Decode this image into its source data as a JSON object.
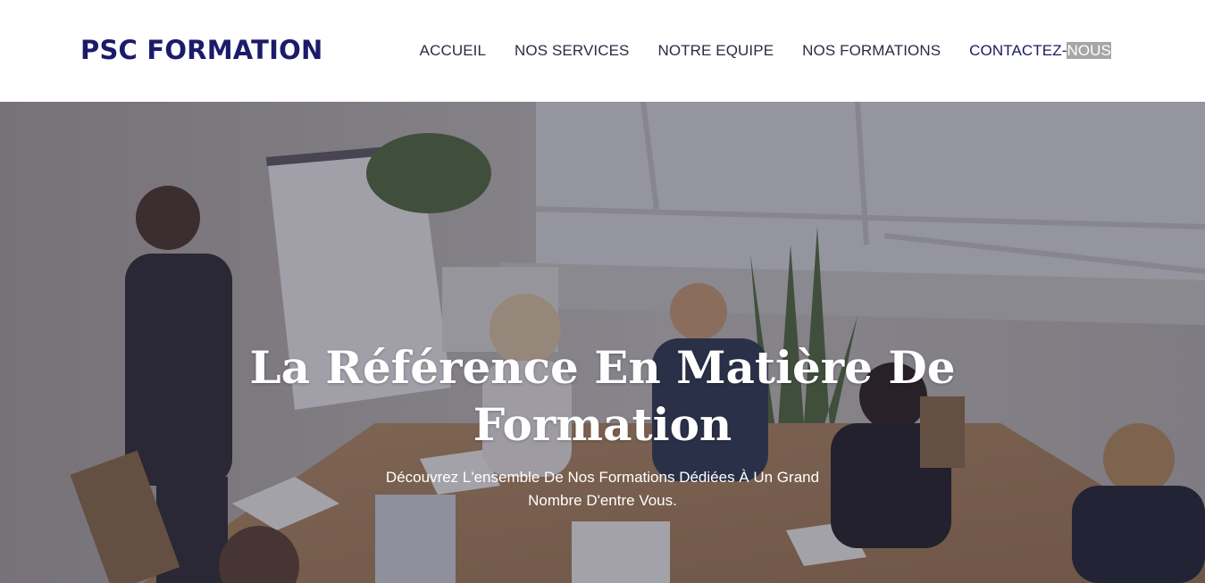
{
  "colors": {
    "brand": "#1b1b6b",
    "nav_text": "#2b2b45",
    "highlight_bg": "#a6a6a6",
    "hero_text": "#ffffff"
  },
  "header": {
    "logo": "PSC FORMATION",
    "nav": {
      "accueil": "ACCUEIL",
      "services": "NOS SERVICES",
      "equipe": "NOTRE EQUIPE",
      "formations": "NOS FORMATIONS",
      "contact_prefix": "CONTACTEZ-",
      "contact_suffix": "NOUS"
    }
  },
  "hero": {
    "title": "La Référence En Matière De Formation",
    "subtitle": "Découvrez L'ensemble De Nos Formations Dédiées À Un Grand Nombre D'entre Vous.",
    "background_image": "meeting-room-photo"
  }
}
